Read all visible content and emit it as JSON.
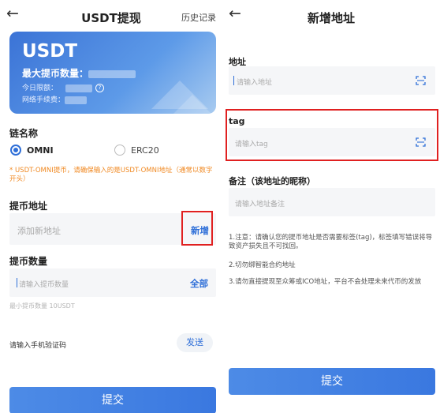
{
  "left": {
    "header": {
      "back_icon": "arrow-left-icon",
      "title": "USDT提现",
      "history": "历史记录"
    },
    "card": {
      "title": "USDT",
      "max_label": "最大提币数量：",
      "daily_limit_label": "今日限额：",
      "fee_label": "网络手续费：",
      "help_icon": "question-circle-icon"
    },
    "chain": {
      "label": "链名称",
      "options": [
        {
          "label": "OMNI",
          "selected": true
        },
        {
          "label": "ERC20",
          "selected": false
        }
      ],
      "warning": "* USDT-OMNI提币，请确保输入的是USDT-OMNI地址（通常以数字开头）"
    },
    "address": {
      "label": "提币地址",
      "placeholder": "添加新地址",
      "add_button": "新增"
    },
    "amount": {
      "label": "提币数量",
      "placeholder": "请输入提币数量",
      "all_button": "全部",
      "min_hint": "最小提币数量 10USDT"
    },
    "verify": {
      "label": "请输入手机验证码",
      "send_button": "发送"
    },
    "submit": "提交"
  },
  "right": {
    "header": {
      "back_icon": "arrow-left-icon",
      "title": "新增地址"
    },
    "address": {
      "label": "地址",
      "placeholder": "请输入地址",
      "scan_icon": "scan-icon"
    },
    "tag": {
      "label": "tag",
      "placeholder": "请输入tag",
      "scan_icon": "scan-icon"
    },
    "remark": {
      "label": "备注（该地址的昵称）",
      "placeholder": "请输入地址备注"
    },
    "notes": [
      "1.注意：请确认您的提币地址是否需要标签(tag)，标签填写错误将导致资产损失且不可找回。",
      "2.切勿绑智能合约地址",
      "3.请勿直接提现至众筹或ICO地址，平台不会处理未来代币的发放"
    ],
    "submit": "提交"
  },
  "colors": {
    "accent": "#2f6fd8",
    "warning": "#f08a24",
    "highlight": "#e02020"
  }
}
